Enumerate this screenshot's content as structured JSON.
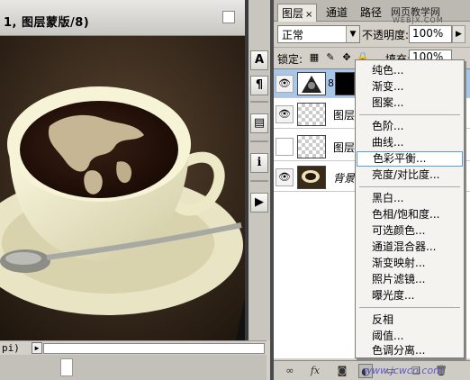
{
  "document": {
    "title": "1, 图层蒙版/8)",
    "status_zoom": "pi)"
  },
  "tools": {
    "items": [
      {
        "name": "type-tool-icon",
        "glyph": "A"
      },
      {
        "name": "paragraph-icon",
        "glyph": "¶"
      },
      {
        "name": "notes-icon",
        "glyph": "▤"
      },
      {
        "name": "info-icon",
        "glyph": "ℹ"
      },
      {
        "name": "actions-icon",
        "glyph": "▶"
      }
    ]
  },
  "layers_panel": {
    "tabs": [
      {
        "label": "图层",
        "close": "×",
        "active": true
      },
      {
        "label": "通道",
        "active": false
      },
      {
        "label": "路径",
        "active": false
      }
    ],
    "watermark_top": "网页教学网",
    "watermark_sub": "WEBJX.COM",
    "blend_mode": "正常",
    "opacity_label": "不透明度:",
    "opacity_value": "100%",
    "lock_label": "锁定:",
    "fill_label": "填充:",
    "fill_value": "100%",
    "layers": [
      {
        "name": "",
        "selected": true
      },
      {
        "name": "图层",
        "selected": false
      },
      {
        "name": "图层",
        "selected": false
      },
      {
        "name": "背景",
        "selected": false
      }
    ],
    "footer_watermark": "www.jcwcn.com"
  },
  "adjustment_menu": {
    "group1": [
      "纯色...",
      "渐变...",
      "图案..."
    ],
    "group2": [
      "色阶...",
      "曲线...",
      "色彩平衡...",
      "亮度/对比度..."
    ],
    "group3": [
      "黑白...",
      "色相/饱和度...",
      "可选颜色...",
      "通道混合器...",
      "渐变映射...",
      "照片滤镜...",
      "曝光度..."
    ],
    "group4": [
      "反相",
      "阈值...",
      "色调分离..."
    ],
    "highlighted": "色彩平衡..."
  },
  "colors": {
    "selection": "#a6c6ea",
    "menu_highlight_border": "#5f9cd4",
    "coffee": "#2a1810",
    "cup": "#f1efcf"
  }
}
